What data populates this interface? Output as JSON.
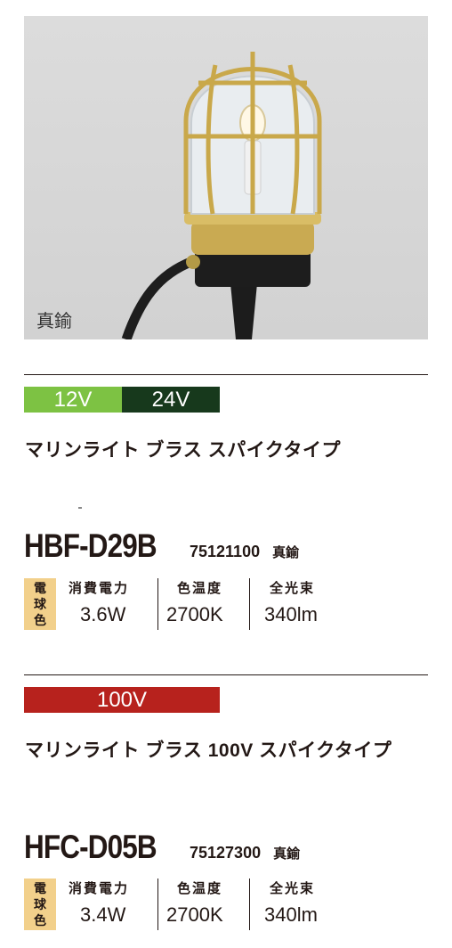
{
  "photo": {
    "caption": "真鍮"
  },
  "section1": {
    "voltages": [
      {
        "label": "12V",
        "color": "#7dc243"
      },
      {
        "label": "24V",
        "color": "#17391c"
      }
    ],
    "product_name": "マリンライト ブラス スパイクタイプ",
    "model_code": "HBF-D29B",
    "model_number": "75121100",
    "finish": "真鍮",
    "badge": "電球色",
    "specs": [
      {
        "label": "消費電力",
        "value": "3.6W"
      },
      {
        "label": "色温度",
        "value": "2700K"
      },
      {
        "label": "全光束",
        "value": "340lm"
      }
    ]
  },
  "section2": {
    "voltages": [
      {
        "label": "100V",
        "color": "#b7221d"
      }
    ],
    "product_name": "マリンライト ブラス 100V スパイクタイプ",
    "model_code": "HFC-D05B",
    "model_number": "75127300",
    "finish": "真鍮",
    "badge": "電球色",
    "specs": [
      {
        "label": "消費電力",
        "value": "3.4W"
      },
      {
        "label": "色温度",
        "value": "2700K"
      },
      {
        "label": "全光束",
        "value": "340lm"
      }
    ]
  }
}
